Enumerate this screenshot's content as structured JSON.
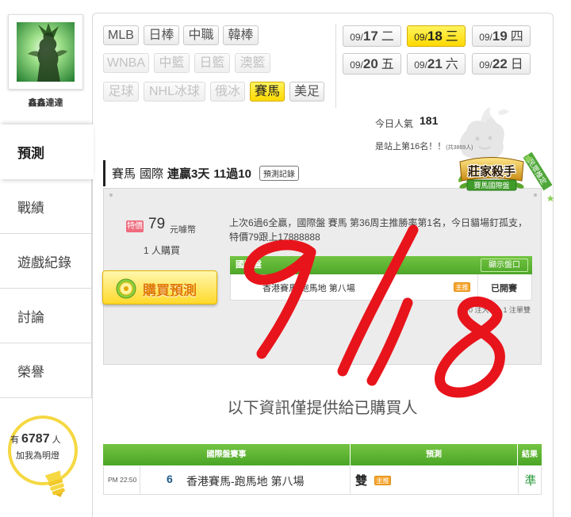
{
  "sidebar": {
    "username": "鑫鑫達達",
    "nav": [
      {
        "label": "預測",
        "active": true
      },
      {
        "label": "戰績",
        "active": false
      },
      {
        "label": "遊戲紀錄",
        "active": false
      },
      {
        "label": "討論",
        "active": false
      },
      {
        "label": "榮譽",
        "active": false
      }
    ],
    "fans": {
      "prefix": "有",
      "count": "6787",
      "suffix": "人",
      "cta": "加我為明燈"
    }
  },
  "sports": [
    {
      "label": "MLB"
    },
    {
      "label": "日棒"
    },
    {
      "label": "中職"
    },
    {
      "label": "韓棒"
    },
    {
      "label": "WNBA",
      "disabled": true
    },
    {
      "label": "中籃",
      "disabled": true
    },
    {
      "label": "日籃",
      "disabled": true
    },
    {
      "label": "澳籃",
      "disabled": true
    },
    {
      "label": "足球",
      "disabled": true
    },
    {
      "label": "NHL冰球",
      "disabled": true
    },
    {
      "label": "俄冰",
      "disabled": true
    },
    {
      "label": "賽馬",
      "active": true
    },
    {
      "label": "美足"
    }
  ],
  "dates": [
    {
      "month": "09/",
      "day": "17",
      "weekday": "二"
    },
    {
      "month": "09/",
      "day": "18",
      "weekday": "三",
      "active": true
    },
    {
      "month": "09/",
      "day": "19",
      "weekday": "四"
    },
    {
      "month": "09/",
      "day": "20",
      "weekday": "五"
    },
    {
      "month": "09/",
      "day": "21",
      "weekday": "六"
    },
    {
      "month": "09/",
      "day": "22",
      "weekday": "日"
    }
  ],
  "stats": {
    "popularity_label": "今日人氣",
    "popularity_value": "181",
    "rank_text": "是站上第16名！！",
    "total_text": "(共3869人)"
  },
  "header": {
    "sport": "賽馬",
    "market": "國際",
    "streak": "連贏3天",
    "record": "11過10",
    "record_button": "預測記錄"
  },
  "badge": {
    "title": "莊家殺手",
    "subtitle": "賽馬國際盤",
    "tag": "民眾推定"
  },
  "purchase": {
    "price_tag": "特價",
    "price": "79",
    "currency": "元噱幣",
    "buyers": "1 人購買",
    "buy_button": "購買預測",
    "description": "上次6過6全贏，國際盤 賽馬 第36周主推勝率第1名，今日貓場釘孤支，特價79跟上17888888",
    "table": {
      "header": "國際盤",
      "show_odds_button": "顯示盤口",
      "game": "香港賽馬-跑馬地 第八場",
      "pick_badge": "主推",
      "status": "已開賽"
    },
    "note": "0 注大小，1 注單雙"
  },
  "notice": "以下資訊僅提供給已購買人",
  "results": {
    "columns": [
      "國際盤賽事",
      "預測",
      "結果"
    ],
    "rows": [
      {
        "time": "PM 22:50",
        "number": "6",
        "game": "香港賽馬-跑馬地 第八場",
        "pick": "雙",
        "pick_badge": "主推",
        "result": "準"
      }
    ]
  },
  "annotation": {
    "handwritten_text": "9/18",
    "color": "#e8141b"
  },
  "icons": {
    "buy": "coin-icon",
    "fans": "lightbulb-icon",
    "decoration": "mascot-icon"
  },
  "colors": {
    "accent_yellow": "#ffe033",
    "header_green": "#5bb52e",
    "result_green": "#2a9a3a",
    "tag_red": "#ef6b7e",
    "badge_orange": "#f6a531"
  }
}
